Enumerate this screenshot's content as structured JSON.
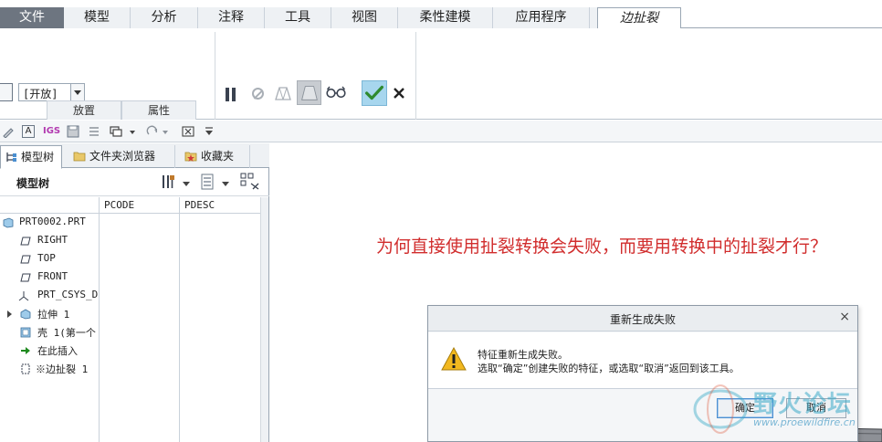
{
  "ribbon": {
    "tabs": [
      {
        "label": "文件"
      },
      {
        "label": "模型"
      },
      {
        "label": "分析"
      },
      {
        "label": "注释"
      },
      {
        "label": "工具"
      },
      {
        "label": "视图"
      },
      {
        "label": "柔性建模"
      },
      {
        "label": "应用程序"
      },
      {
        "label": "边扯裂"
      }
    ],
    "active_tab": "边扯裂",
    "combo_value": "[开放]",
    "group_labels": [
      "放置",
      "属性"
    ],
    "accent_check": "#2f8a2f",
    "ok_button_bg": "#a7d6ee"
  },
  "quick_access": {
    "icons": [
      "regenerate-icon",
      "text-icon",
      "igs-icon",
      "save-icon",
      "regen-manager-icon",
      "window-icon",
      "redo-icon",
      "close-window-icon",
      "customize-icon"
    ],
    "igs_label": "IGS",
    "text_label": "A"
  },
  "left_panel": {
    "tabs": [
      {
        "label": "模型树",
        "icon": "model-tree-icon"
      },
      {
        "label": "文件夹浏览器",
        "icon": "folder-icon"
      },
      {
        "label": "收藏夹",
        "icon": "favorites-icon"
      }
    ],
    "header_title": "模型树",
    "columns": [
      "PCODE",
      "PDESC"
    ],
    "tree": [
      {
        "label": "PRT0002.PRT",
        "icon": "part-icon"
      },
      {
        "label": "RIGHT",
        "icon": "datum-plane-icon"
      },
      {
        "label": "TOP",
        "icon": "datum-plane-icon"
      },
      {
        "label": "FRONT",
        "icon": "datum-plane-icon"
      },
      {
        "label": "PRT_CSYS_DEF",
        "icon": "csys-icon"
      },
      {
        "label": "拉伸 1",
        "icon": "extrude-icon"
      },
      {
        "label": "壳 1(第一个",
        "icon": "shell-icon"
      },
      {
        "label": "在此插入",
        "icon": "insert-here-icon"
      },
      {
        "label": "※边扯裂 1",
        "icon": "edge-rip-icon"
      }
    ]
  },
  "graphics": {
    "question": "为何直接使用扯裂转换会失败，而要用转换中的扯裂才行？",
    "question_color": "#d12d2d"
  },
  "dialog": {
    "title": "重新生成失败",
    "close": "×",
    "line1": "特征重新生成失败。",
    "line2": "选取“确定”创建失败的特征，或选取“取消”返回到该工具。",
    "ok_label": "确定",
    "cancel_label": "取消",
    "icon": "warning-icon"
  },
  "watermark": {
    "brand": "野火论坛",
    "url": "www.proewildfire.cn"
  }
}
